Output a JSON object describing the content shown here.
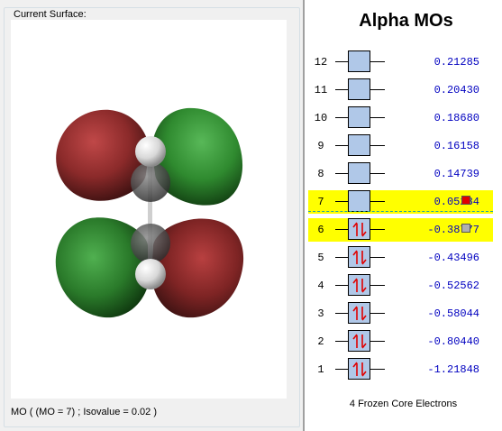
{
  "surface": {
    "group_label": "Current Surface:",
    "status": "MO ( (MO = 7) ; Isovalue = 0.02 )"
  },
  "mo_panel": {
    "title": "Alpha MOs",
    "frozen_core": "4 Frozen Core Electrons",
    "orbitals": [
      {
        "num": "12",
        "energy": "0.21285",
        "occupied": false,
        "highlight": false
      },
      {
        "num": "11",
        "energy": "0.20430",
        "occupied": false,
        "highlight": false
      },
      {
        "num": "10",
        "energy": "0.18680",
        "occupied": false,
        "highlight": false
      },
      {
        "num": "9",
        "energy": "0.16158",
        "occupied": false,
        "highlight": false
      },
      {
        "num": "8",
        "energy": "0.14739",
        "occupied": false,
        "highlight": false
      },
      {
        "num": "7",
        "energy": "0.05284",
        "occupied": false,
        "highlight": true
      },
      {
        "num": "6",
        "energy": "-0.38777",
        "occupied": true,
        "highlight": true
      },
      {
        "num": "5",
        "energy": "-0.43496",
        "occupied": true,
        "highlight": false
      },
      {
        "num": "4",
        "energy": "-0.52562",
        "occupied": true,
        "highlight": false
      },
      {
        "num": "3",
        "energy": "-0.58044",
        "occupied": true,
        "highlight": false
      },
      {
        "num": "2",
        "energy": "-0.80440",
        "occupied": true,
        "highlight": false
      },
      {
        "num": "1",
        "energy": "-1.21848",
        "occupied": true,
        "highlight": false
      }
    ],
    "lumo_indicator_color": "#e00000",
    "homo_indicator_color": "#b0b0b0"
  },
  "colors": {
    "lobe_red": "#8b2a2a",
    "lobe_green": "#2f8a2f",
    "orbital_box": "#b0c8e8",
    "highlight": "#ffff00",
    "energy_text": "#0000c0",
    "arrow": "#e00000"
  }
}
